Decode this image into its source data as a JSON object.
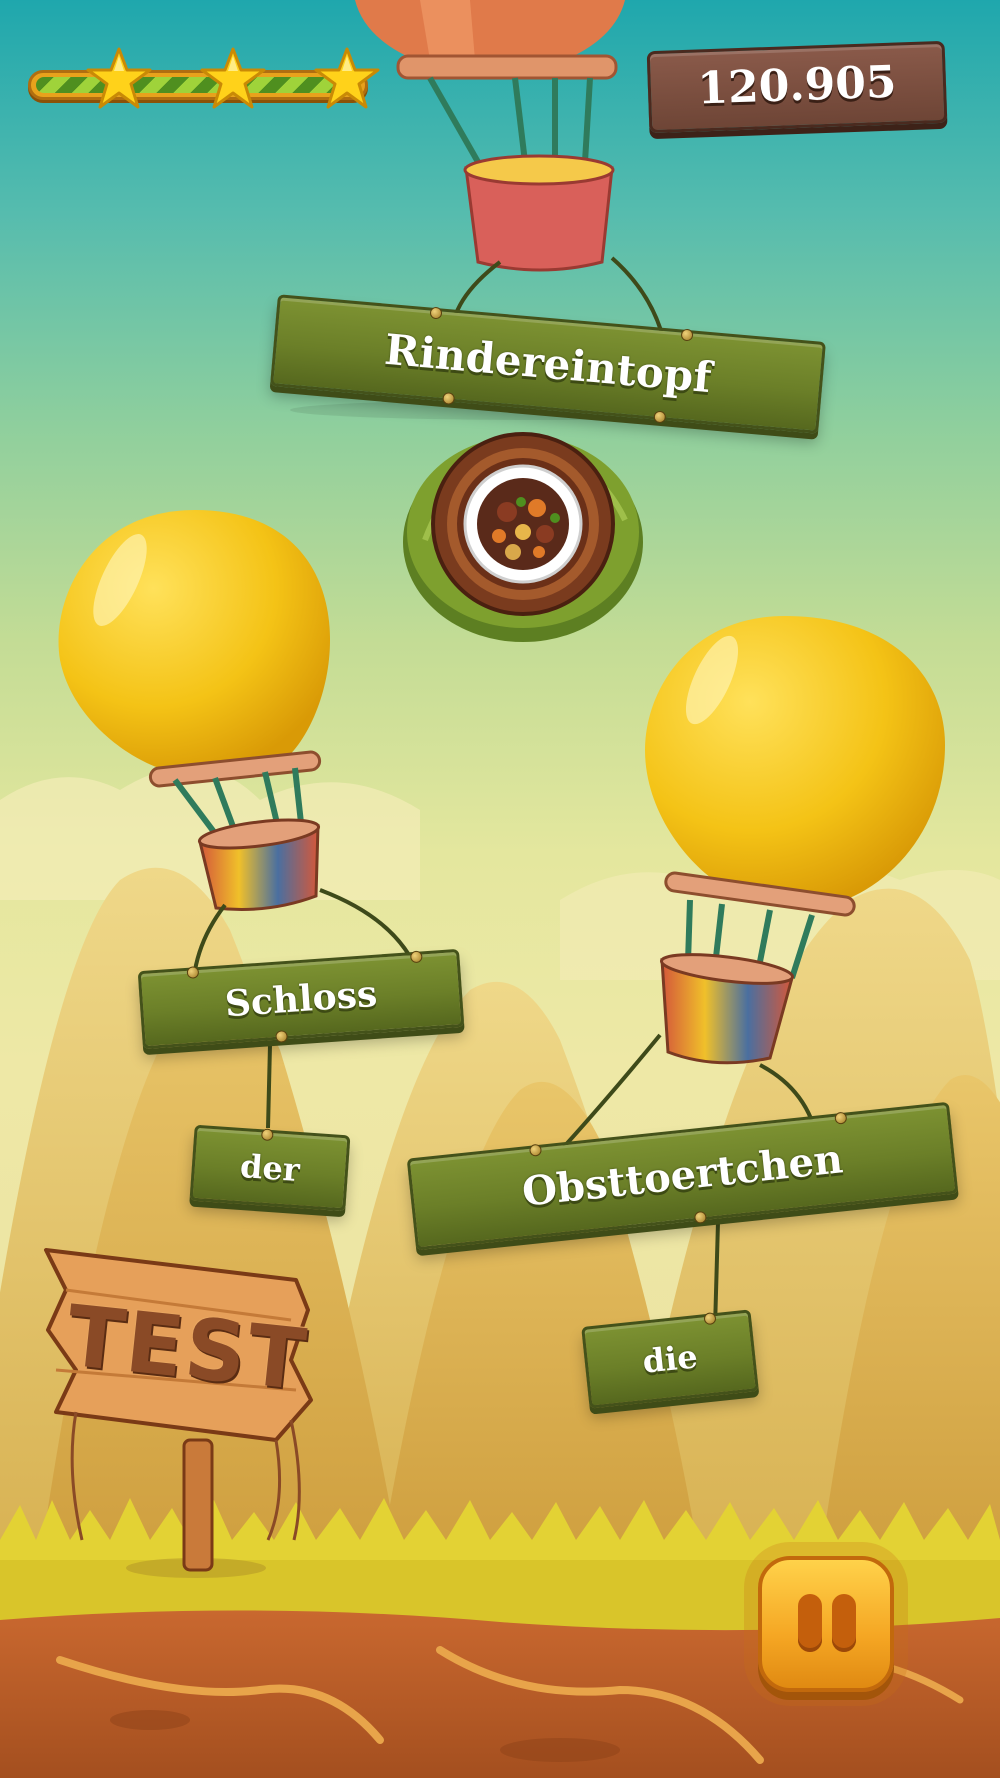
{
  "hud": {
    "score": "120.905",
    "stars_earned": 3,
    "stars_total": 3,
    "progress": 1.0
  },
  "level_target": {
    "dish_name": "Rindereintopf",
    "dish_icon": "stew-bowl-icon"
  },
  "word_planks": [
    {
      "label": "Schloss"
    },
    {
      "label": "der"
    },
    {
      "label": "Obsttoertchen"
    },
    {
      "label": "die"
    }
  ],
  "test_sign": {
    "label": "TEST"
  },
  "controls": {
    "pause_icon": "pause-icon"
  },
  "colors": {
    "plank_green": "#6b7f28",
    "balloon_yellow": "#f2c417",
    "score_plank": "#7a4c3c",
    "pause_orange": "#f5a623",
    "sky_top": "#1fa7ad"
  }
}
